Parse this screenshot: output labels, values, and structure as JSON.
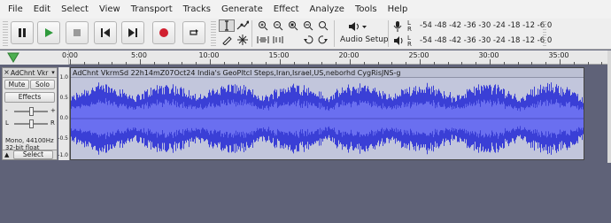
{
  "menu": [
    "File",
    "Edit",
    "Select",
    "View",
    "Transport",
    "Tracks",
    "Generate",
    "Effect",
    "Analyze",
    "Tools",
    "Help"
  ],
  "toolbar": {
    "audio_setup_label": "Audio Setup",
    "record_meter_scale": "-54 -48 -42 -36 -30 -24 -18 -12  -6  0",
    "playback_meter_scale": "-54 -48 -42 -36 -30 -24 -18 -12  -6  0",
    "channel_l": "L",
    "channel_r": "R",
    "record_color": "#d11f2f",
    "play_color": "#2f9a3c",
    "accent_color": "#3a3fd6"
  },
  "ruler": {
    "ticks": [
      "0:00",
      "5:00",
      "10:00",
      "15:00",
      "20:00",
      "25:00",
      "30:00",
      "35:00"
    ]
  },
  "track": {
    "name": "AdChnt Vkr",
    "mute_label": "Mute",
    "solo_label": "Solo",
    "effects_label": "Effects",
    "gain_minus": "-",
    "gain_plus": "+",
    "pan_left": "L",
    "pan_right": "R",
    "format_line1": "Mono, 44100Hz",
    "format_line2": "32-bit float",
    "select_label": "Select",
    "close_glyph": "×",
    "menu_glyph": "▾",
    "collapse_glyph": "▲",
    "vertical_scale": [
      "1.0",
      "0.5",
      "0.0",
      "-0.5",
      "-1.0"
    ],
    "clip_title": "AdChnt VkrmSd 22h14mZ07Oct24 India's GeoPltcl Steps,Iran,Israel,US,neborhd CygRisJNS-g",
    "waveform_color": "#3a3fd6",
    "clip_bg_color": "#c2c6dc"
  }
}
